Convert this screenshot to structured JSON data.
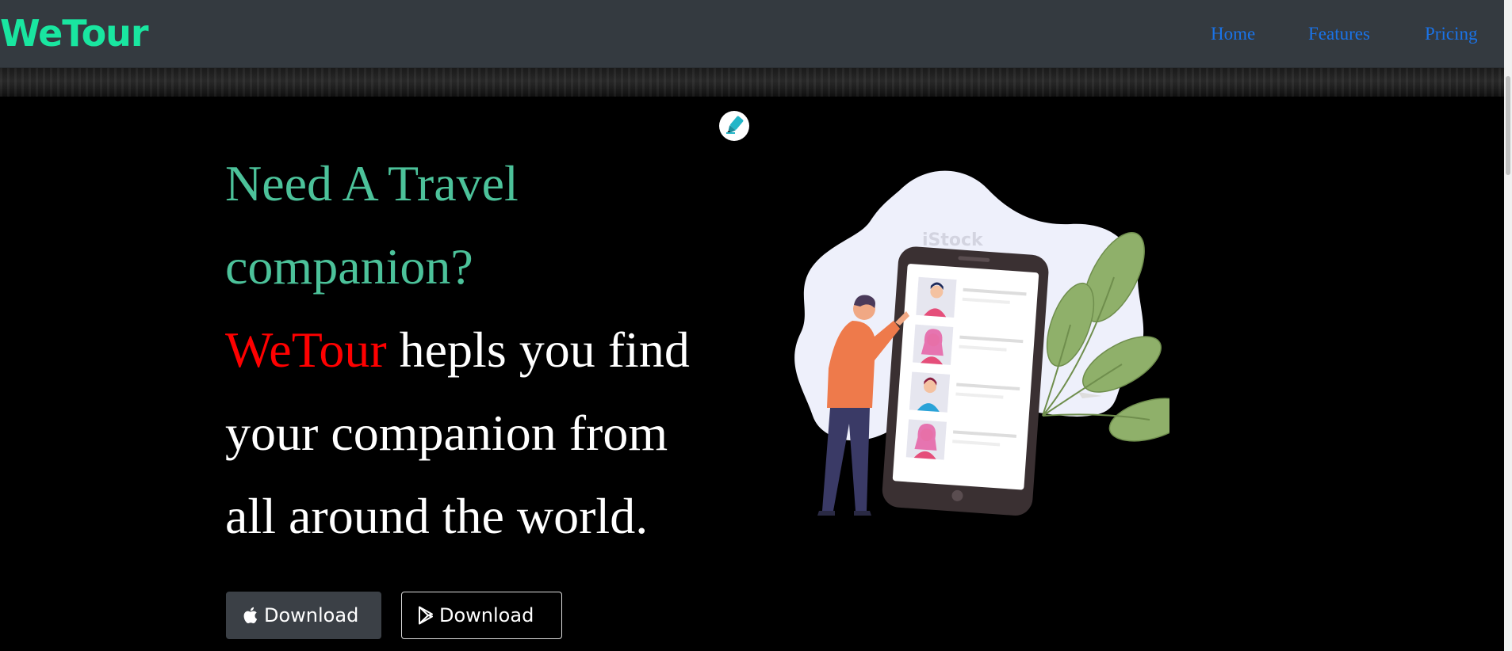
{
  "navbar": {
    "brand": "WeTour",
    "links": [
      {
        "label": "Home"
      },
      {
        "label": "Features"
      },
      {
        "label": "Pricing"
      }
    ]
  },
  "hero": {
    "question_line1": "Need A Travel",
    "question_line2": "companion?",
    "brand_word": "WeTour",
    "tagline_part1": " hepls you find",
    "tagline_line2": "your companion from",
    "tagline_line3": "all around the world."
  },
  "buttons": {
    "apple_download": "Download",
    "play_download": "Download"
  },
  "illustration": {
    "watermark": "iStock"
  },
  "icons": {
    "edit": "highlighter-icon",
    "apple": "apple-icon",
    "play": "google-play-icon"
  },
  "colors": {
    "navbar_bg": "#343a40",
    "brand": "#19e6a0",
    "nav_link": "#1a73e8",
    "headline_teal": "#4cc29a",
    "brand_red": "#ff0000",
    "hero_bg": "#000000"
  }
}
